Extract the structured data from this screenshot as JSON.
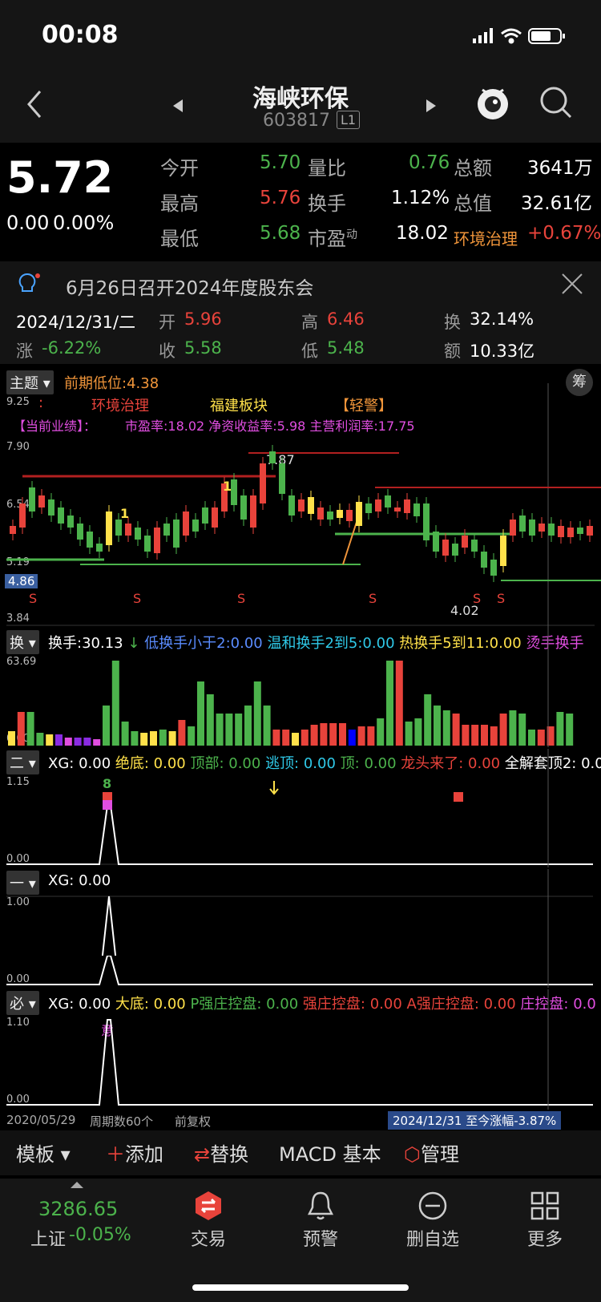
{
  "status_bar": {
    "time": "00:08"
  },
  "header": {
    "title": "海峡环保",
    "code": "603817",
    "level": "L1"
  },
  "quote": {
    "price": "5.72",
    "change": "0.00",
    "change_pct": "0.00%",
    "rows": [
      {
        "l1": "今开",
        "v1": "5.70",
        "l2": "量比",
        "v2": "0.76",
        "l3": "总额",
        "v3": "3641万"
      },
      {
        "l1": "最高",
        "v1": "5.76",
        "l2": "换手",
        "v2": "1.12%",
        "l3": "总值",
        "v3": "32.61亿"
      },
      {
        "l1": "最低",
        "v1": "5.68",
        "l2": "市盈",
        "l2_sup": "动",
        "v2": "18.02",
        "l3": "环境治理",
        "v3": "+0.67%"
      }
    ]
  },
  "notice": {
    "text": "6月26日召开2024年度股东会"
  },
  "day_info": {
    "date": "2024/12/31/二",
    "open_label": "开",
    "open": "5.96",
    "high_label": "高",
    "high": "6.46",
    "turnover_label": "换",
    "turnover": "32.14%",
    "chg_label": "涨",
    "chg": "-6.22%",
    "close_label": "收",
    "close": "5.58",
    "low_label": "低",
    "low": "5.48",
    "amount_label": "额",
    "amount": "10.33亿"
  },
  "main_panel": {
    "tag": "主题",
    "prev_low": "前期低位:4.38",
    "chip_btn": "筹",
    "sector1": "环境治理",
    "sector2": "福建板块",
    "warn": "【轻警】",
    "perf_label": "【当前业绩】：",
    "perf": "市盈率:18.02 净资收益率:5.98 主营利润率:17.75",
    "y_ticks": [
      "9.25",
      "7.90",
      "6.54",
      "5.19",
      "3.84"
    ],
    "cur_price_tag": "4.86",
    "max_label": "7.87",
    "min_label": "4.02",
    "marker1": "1",
    "s_mark": "S"
  },
  "chart_data": {
    "type": "candlestick",
    "y_ticks": [
      9.25,
      7.9,
      6.54,
      5.19,
      3.84
    ],
    "ylim": [
      3.84,
      9.25
    ],
    "high_label": 7.87,
    "low_label": 4.02,
    "price_tag": 4.86
  },
  "turnover_panel": {
    "tag": "换",
    "items": [
      {
        "text": "换手:30.13",
        "color": "#ffffff"
      },
      {
        "text": "↓",
        "color": "#4cb34c"
      },
      {
        "text": "低换手小于2:0.00",
        "color": "#5a8cff"
      },
      {
        "text": "温和换手2到5:0.00",
        "color": "#2fc9e8"
      },
      {
        "text": "热换手5到11:0.00",
        "color": "#ffe14a"
      },
      {
        "text": "烫手换手",
        "color": "#e14ee1"
      }
    ],
    "y_top": "63.69",
    "y_bottom": "0.00"
  },
  "panel2": {
    "tag": "二",
    "items": [
      {
        "text": "XG: 0.00",
        "color": "#ffffff"
      },
      {
        "text": "绝底: 0.00",
        "color": "#ffe14a"
      },
      {
        "text": "顶部: 0.00",
        "color": "#4cb34c"
      },
      {
        "text": "逃顶: 0.00",
        "color": "#2fc9e8"
      },
      {
        "text": "顶: 0.00",
        "color": "#4cb34c"
      },
      {
        "text": "龙头来了: 0.00",
        "color": "#e8433b"
      },
      {
        "text": "全解套顶2: 0.00",
        "color": "#ffffff"
      }
    ],
    "y_top": "1.15",
    "y_bottom": "0.00",
    "mark": "8"
  },
  "panel3": {
    "tag": "一",
    "items": [
      {
        "text": "XG: 0.00",
        "color": "#ffffff"
      }
    ],
    "y_top": "1.00",
    "y_bottom": "0.00"
  },
  "panel4": {
    "tag": "必",
    "items": [
      {
        "text": "XG: 0.00",
        "color": "#ffffff"
      },
      {
        "text": "大底: 0.00",
        "color": "#ffe14a"
      },
      {
        "text": "P强庄控盘: 0.00",
        "color": "#4cb34c"
      },
      {
        "text": "强庄控盘: 0.00",
        "color": "#e8433b"
      },
      {
        "text": "A强庄控盘: 0.00",
        "color": "#e8433b"
      },
      {
        "text": "庄控盘: 0.0",
        "color": "#e14ee1"
      }
    ],
    "y_top": "1.10",
    "y_bottom": "0.00",
    "mark": "意"
  },
  "footer_info": {
    "start_date": "2020/05/29",
    "period": "周期数60个",
    "adjust": "前复权",
    "range": "2024/12/31 至今涨幅-3.87%"
  },
  "toolbar": {
    "template": "模板",
    "add": "添加",
    "replace": "替换",
    "macd": "MACD 基本",
    "manage": "管理"
  },
  "tabbar": {
    "index_value": "3286.65",
    "index_name": "上证",
    "index_chg": "-0.05%",
    "tabs": [
      "交易",
      "预警",
      "删自选",
      "更多"
    ]
  },
  "colors": {
    "up": "#e8433b",
    "down": "#4cb34c",
    "bg": "#000000",
    "accent": "#ffe14a"
  }
}
